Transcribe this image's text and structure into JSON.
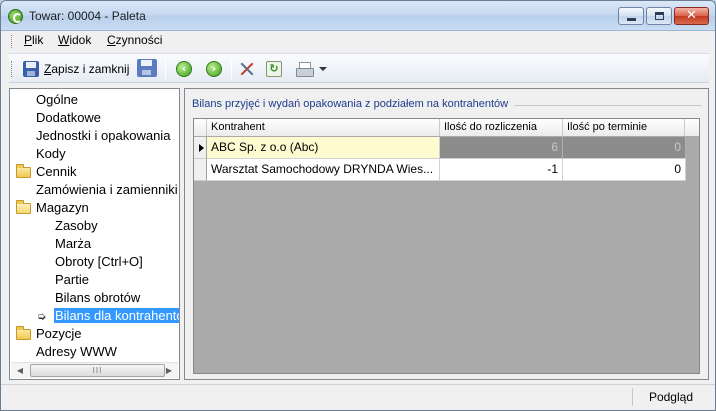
{
  "window": {
    "title": "Towar: 00004 - Paleta"
  },
  "menu": {
    "items": [
      {
        "label": "Plik",
        "accel": "P",
        "rest": "lik"
      },
      {
        "label": "Widok",
        "accel": "W",
        "rest": "idok"
      },
      {
        "label": "Czynności",
        "accel": "C",
        "rest": "zynności"
      }
    ]
  },
  "toolbar": {
    "save_close_accel": "Z",
    "save_close_rest": "apisz i zamknij",
    "icons": [
      "save-icon",
      "save-as-icon",
      "back-icon",
      "forward-icon",
      "tools-icon",
      "refresh-icon",
      "print-icon"
    ]
  },
  "tree": {
    "items": [
      {
        "label": "Ogólne",
        "level": 0,
        "folder": false
      },
      {
        "label": "Dodatkowe",
        "level": 0,
        "folder": false
      },
      {
        "label": "Jednostki i opakowania",
        "level": 0,
        "folder": false
      },
      {
        "label": "Kody",
        "level": 0,
        "folder": false
      },
      {
        "label": "Cennik",
        "level": 0,
        "folder": true
      },
      {
        "label": "Zamówienia i zamienniki",
        "level": 0,
        "folder": false
      },
      {
        "label": "Magazyn",
        "level": 0,
        "folder": true,
        "open": true
      },
      {
        "label": "Zasoby",
        "level": 1,
        "folder": false
      },
      {
        "label": "Marża",
        "level": 1,
        "folder": false
      },
      {
        "label": "Obroty [Ctrl+O]",
        "level": 1,
        "folder": false
      },
      {
        "label": "Partie",
        "level": 1,
        "folder": false
      },
      {
        "label": "Bilans obrotów",
        "level": 1,
        "folder": false
      },
      {
        "label": "Bilans dla kontrahentów",
        "level": 1,
        "folder": false,
        "selected": true
      },
      {
        "label": "Pozycje",
        "level": 0,
        "folder": true
      },
      {
        "label": "Adresy WWW",
        "level": 0,
        "folder": false
      }
    ],
    "scroll_thumb_label": "III"
  },
  "content": {
    "group_title": "Bilans przyjęć i wydań opakowania z podziałem na kontrahentów",
    "columns": [
      "Kontrahent",
      "Ilość do rozliczenia",
      "Ilość po terminie"
    ],
    "rows": [
      {
        "kontrahent": "ABC Sp. z o.o (Abc)",
        "do_rozliczenia": "6",
        "po_terminie": "0"
      },
      {
        "kontrahent": "Warsztat Samochodowy DRYNDA Wies...",
        "do_rozliczenia": "-1",
        "po_terminie": "0"
      }
    ]
  },
  "status": {
    "mode": "Podgląd"
  },
  "colors": {
    "selection": "#3399ff",
    "title_link": "#1e3c8c"
  }
}
